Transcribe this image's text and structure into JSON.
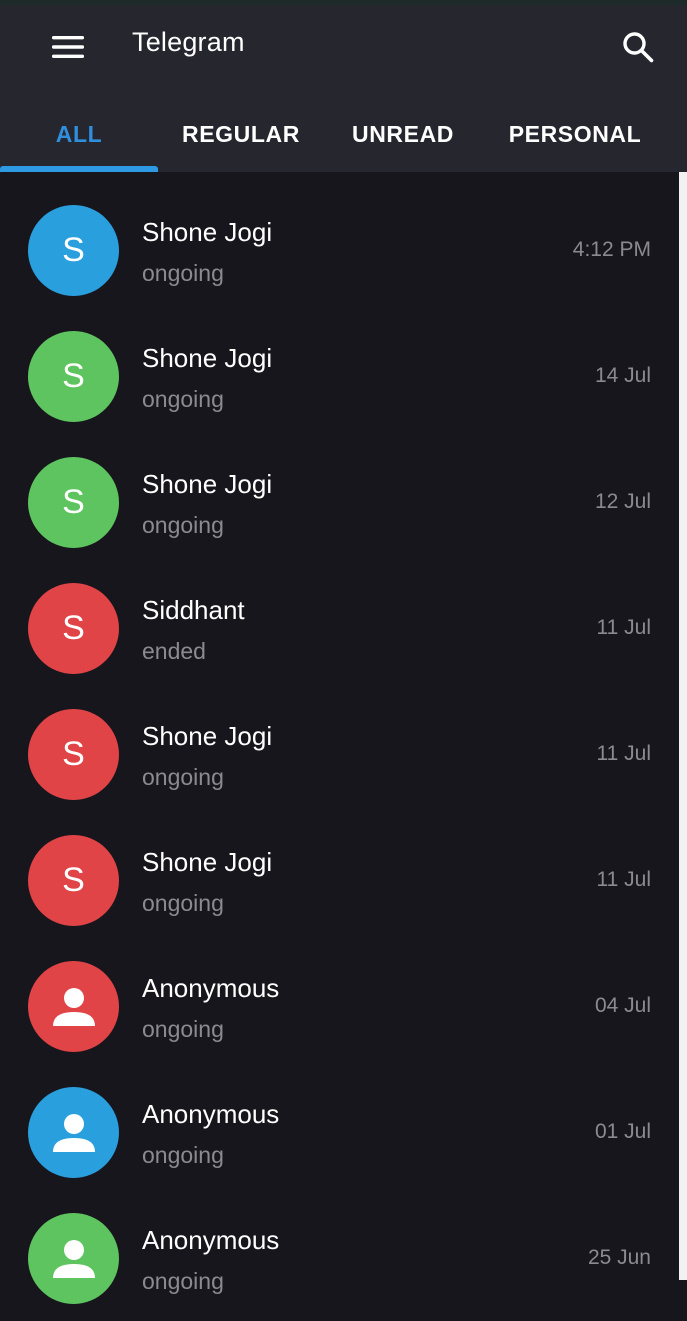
{
  "header": {
    "title": "Telegram",
    "menu_icon": "hamburger-menu-icon",
    "search_icon": "search-icon",
    "background": "#26262f"
  },
  "tabs": [
    {
      "label": "ALL",
      "active": true
    },
    {
      "label": "REGULAR",
      "active": false
    },
    {
      "label": "UNREAD",
      "active": false
    },
    {
      "label": "PERSONAL",
      "active": false
    }
  ],
  "colors": {
    "accent": "#2f8fdd",
    "blue": "#2a9fde",
    "green": "#5ec45f",
    "red": "#e04447",
    "background": "#17161c"
  },
  "chats": [
    {
      "initial": "S",
      "avatar_color": "#2a9fde",
      "name": "Shone Jogi",
      "status": "ongoing",
      "time": "4:12 PM"
    },
    {
      "initial": "S",
      "avatar_color": "#5ec45f",
      "name": "Shone Jogi",
      "status": "ongoing",
      "time": "14 Jul"
    },
    {
      "initial": "S",
      "avatar_color": "#5ec45f",
      "name": "Shone Jogi",
      "status": "ongoing",
      "time": "12 Jul"
    },
    {
      "initial": "S",
      "avatar_color": "#e04447",
      "name": "Siddhant",
      "status": "ended",
      "time": "11 Jul"
    },
    {
      "initial": "S",
      "avatar_color": "#e04447",
      "name": "Shone Jogi",
      "status": "ongoing",
      "time": "11 Jul"
    },
    {
      "initial": "S",
      "avatar_color": "#e04447",
      "name": "Shone Jogi",
      "status": "ongoing",
      "time": "11 Jul"
    },
    {
      "initial": "",
      "avatar_icon": "person-icon",
      "avatar_color": "#e04447",
      "name": "Anonymous",
      "status": "ongoing",
      "time": "04 Jul"
    },
    {
      "initial": "",
      "avatar_icon": "person-icon",
      "avatar_color": "#2a9fde",
      "name": "Anonymous",
      "status": "ongoing",
      "time": "01 Jul"
    },
    {
      "initial": "",
      "avatar_icon": "person-icon",
      "avatar_color": "#5ec45f",
      "name": "Anonymous",
      "status": "ongoing",
      "time": "25 Jun"
    }
  ]
}
